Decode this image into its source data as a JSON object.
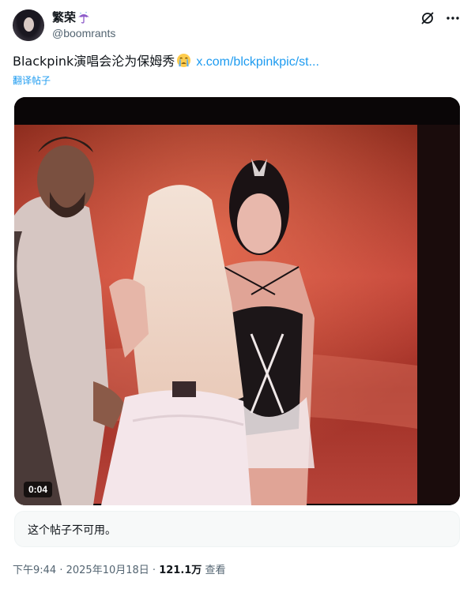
{
  "author": {
    "display_name": "繁荣",
    "handle": "@boomrants"
  },
  "tweet": {
    "text": "Blackpink演唱会沦为保姆秀",
    "link": "x.com/blckpinkpic/st...",
    "translate_label": "翻译帖子"
  },
  "video": {
    "duration": "0:04"
  },
  "notice": {
    "text": "这个帖子不可用。"
  },
  "meta": {
    "time": "下午9:44",
    "sep1": " · ",
    "date": "2025年10月18日",
    "sep2": " · ",
    "views_count": "121.1万",
    "views_label": " 查看"
  },
  "icons": {
    "umbrella": "umbrella-icon",
    "grok": "grok-icon",
    "more": "more-icon",
    "crying_face": "crying-face-emoji"
  },
  "colors": {
    "accent": "#1d9bf0",
    "text": "#0f1419",
    "muted": "#536471"
  }
}
